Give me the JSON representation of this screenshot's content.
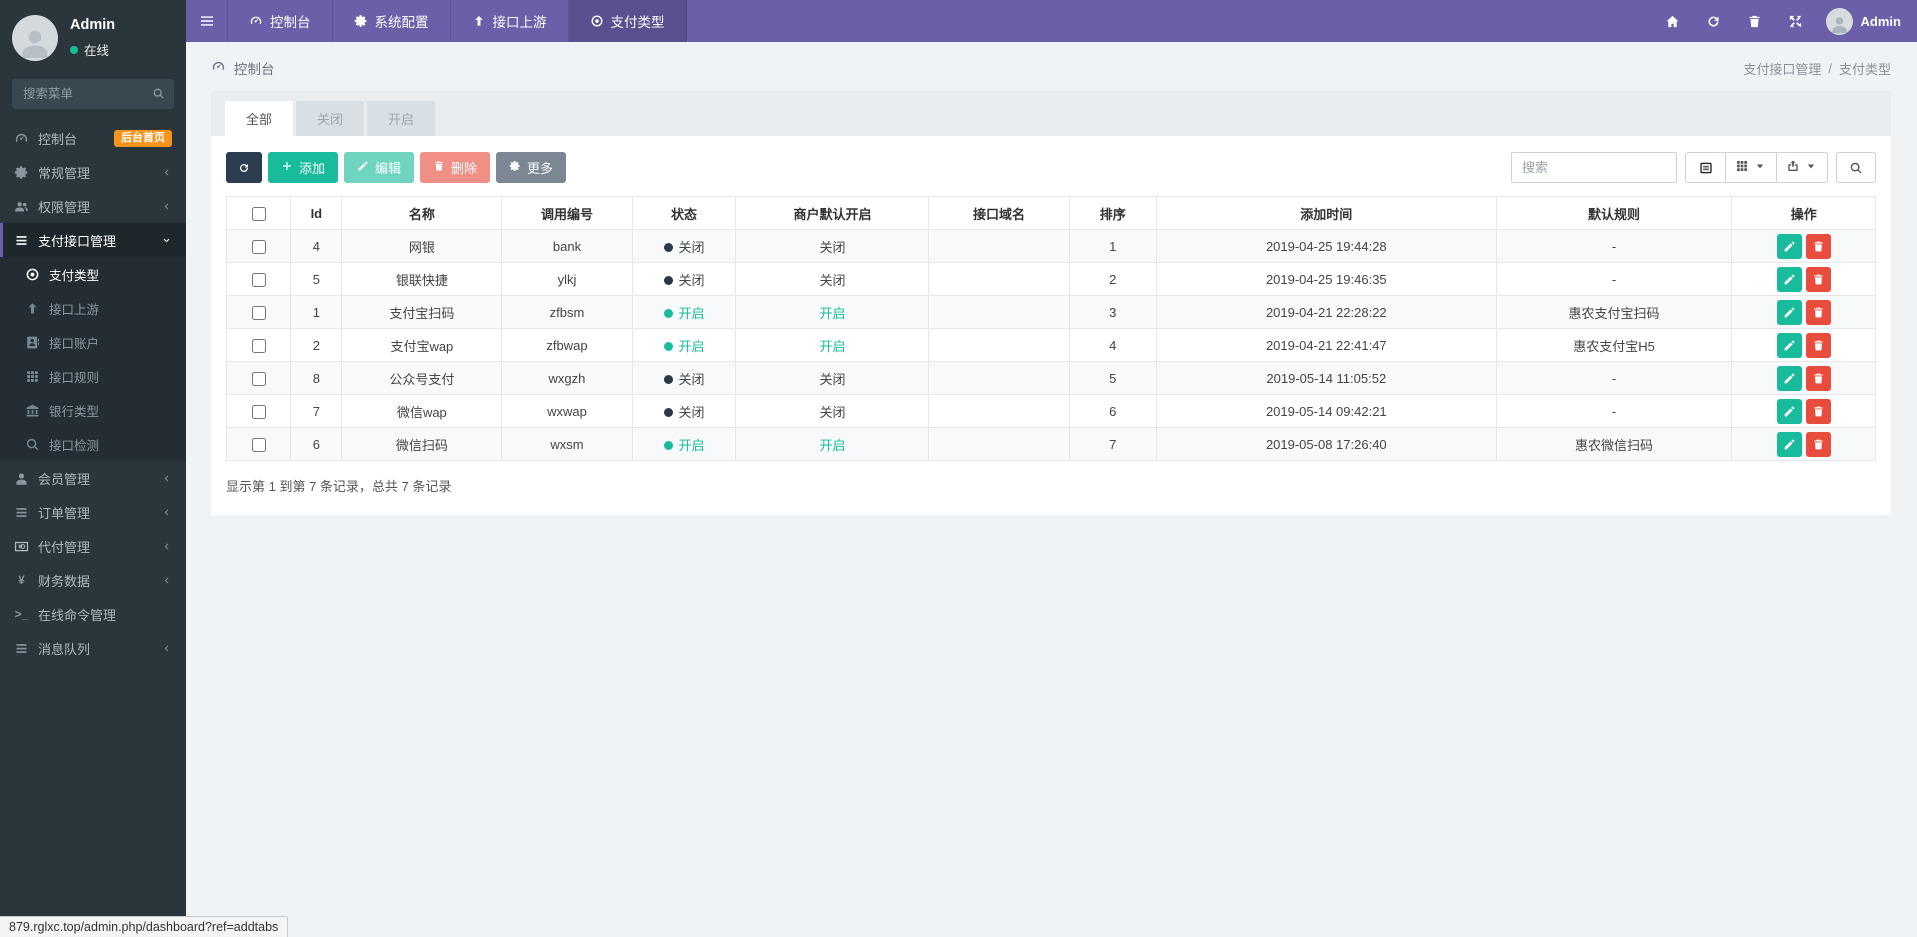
{
  "colors": {
    "topbar": "#6a5fa8",
    "accent_green": "#18bc9c",
    "danger_red": "#e74c3c",
    "badge_orange": "#f7941d",
    "dark_button": "#2c3d50",
    "gray_button": "#7b8893"
  },
  "topnav": {
    "items": [
      {
        "key": "dashboard",
        "label": "控制台",
        "icon": "gauge-icon",
        "active": false
      },
      {
        "key": "system-config",
        "label": "系统配置",
        "icon": "gear-icon",
        "active": false
      },
      {
        "key": "interface-upstream",
        "label": "接口上游",
        "icon": "arrow-up-icon",
        "active": false
      },
      {
        "key": "pay-type",
        "label": "支付类型",
        "icon": "disc-icon",
        "active": true
      }
    ],
    "right_icons": [
      "home-icon",
      "refresh-icon",
      "trash-icon",
      "fullscreen-icon"
    ],
    "username": "Admin"
  },
  "sidebar": {
    "user": {
      "name": "Admin",
      "status": "在线"
    },
    "search_placeholder": "搜索菜单",
    "menu": [
      {
        "key": "dashboard",
        "label": "控制台",
        "icon": "gauge-icon",
        "badge": "后台首页"
      },
      {
        "key": "general",
        "label": "常规管理",
        "icon": "gear-icon",
        "chevron": "left"
      },
      {
        "key": "auth",
        "label": "权限管理",
        "icon": "users-icon",
        "chevron": "left"
      },
      {
        "key": "pay-interface",
        "label": "支付接口管理",
        "icon": "list-icon",
        "chevron": "down",
        "active": true,
        "children": [
          {
            "key": "pay-type",
            "label": "支付类型",
            "icon": "disc-icon",
            "active": true
          },
          {
            "key": "interface-upstream",
            "label": "接口上游",
            "icon": "arrow-up-icon"
          },
          {
            "key": "interface-account",
            "label": "接口账户",
            "icon": "address-book-icon"
          },
          {
            "key": "interface-rule",
            "label": "接口规则",
            "icon": "grid-icon"
          },
          {
            "key": "bank-type",
            "label": "银行类型",
            "icon": "bank-icon"
          },
          {
            "key": "interface-check",
            "label": "接口检测",
            "icon": "search-icon"
          }
        ]
      },
      {
        "key": "member",
        "label": "会员管理",
        "icon": "member-icon",
        "chevron": "left"
      },
      {
        "key": "order",
        "label": "订单管理",
        "icon": "list-icon",
        "chevron": "left"
      },
      {
        "key": "agent-pay",
        "label": "代付管理",
        "icon": "card-icon",
        "chevron": "left"
      },
      {
        "key": "finance",
        "label": "财务数据",
        "icon": "yen-icon",
        "chevron": "left"
      },
      {
        "key": "command",
        "label": "在线命令管理",
        "icon": "terminal-icon"
      },
      {
        "key": "queue",
        "label": "消息队列",
        "icon": "list-icon",
        "chevron": "left"
      }
    ]
  },
  "content": {
    "page_title": "控制台",
    "breadcrumb": {
      "parent": "支付接口管理",
      "separator": "/",
      "current": "支付类型"
    },
    "tabs": [
      {
        "key": "all",
        "label": "全部",
        "active": true
      },
      {
        "key": "closed",
        "label": "关闭",
        "active": false
      },
      {
        "key": "open",
        "label": "开启",
        "active": false
      }
    ],
    "toolbar": {
      "add_label": "添加",
      "edit_label": "编辑",
      "delete_label": "删除",
      "more_label": "更多",
      "search_placeholder": "搜索"
    },
    "table": {
      "columns": [
        "Id",
        "名称",
        "调用编号",
        "状态",
        "商户默认开启",
        "接口域名",
        "排序",
        "添加时间",
        "默认规则",
        "操作"
      ],
      "status_on_label": "开启",
      "status_off_label": "关闭",
      "rows": [
        {
          "id": "4",
          "name": "网银",
          "code": "bank",
          "status": "off",
          "merchant": "off",
          "domain": "",
          "sort": "1",
          "created": "2019-04-25 19:44:28",
          "rule": "-"
        },
        {
          "id": "5",
          "name": "银联快捷",
          "code": "ylkj",
          "status": "off",
          "merchant": "off",
          "domain": "",
          "sort": "2",
          "created": "2019-04-25 19:46:35",
          "rule": "-"
        },
        {
          "id": "1",
          "name": "支付宝扫码",
          "code": "zfbsm",
          "status": "on",
          "merchant": "on",
          "domain": "",
          "sort": "3",
          "created": "2019-04-21 22:28:22",
          "rule": "惠农支付宝扫码"
        },
        {
          "id": "2",
          "name": "支付宝wap",
          "code": "zfbwap",
          "status": "on",
          "merchant": "on",
          "domain": "",
          "sort": "4",
          "created": "2019-04-21 22:41:47",
          "rule": "惠农支付宝H5"
        },
        {
          "id": "8",
          "name": "公众号支付",
          "code": "wxgzh",
          "status": "off",
          "merchant": "off",
          "domain": "",
          "sort": "5",
          "created": "2019-05-14 11:05:52",
          "rule": "-"
        },
        {
          "id": "7",
          "name": "微信wap",
          "code": "wxwap",
          "status": "off",
          "merchant": "off",
          "domain": "",
          "sort": "6",
          "created": "2019-05-14 09:42:21",
          "rule": "-"
        },
        {
          "id": "6",
          "name": "微信扫码",
          "code": "wxsm",
          "status": "on",
          "merchant": "on",
          "domain": "",
          "sort": "7",
          "created": "2019-05-08 17:26:40",
          "rule": "惠农微信扫码"
        }
      ],
      "summary": "显示第 1 到第 7 条记录，总共 7 条记录"
    }
  },
  "statusbar": {
    "url": "879.rglxc.top/admin.php/dashboard?ref=addtabs"
  }
}
